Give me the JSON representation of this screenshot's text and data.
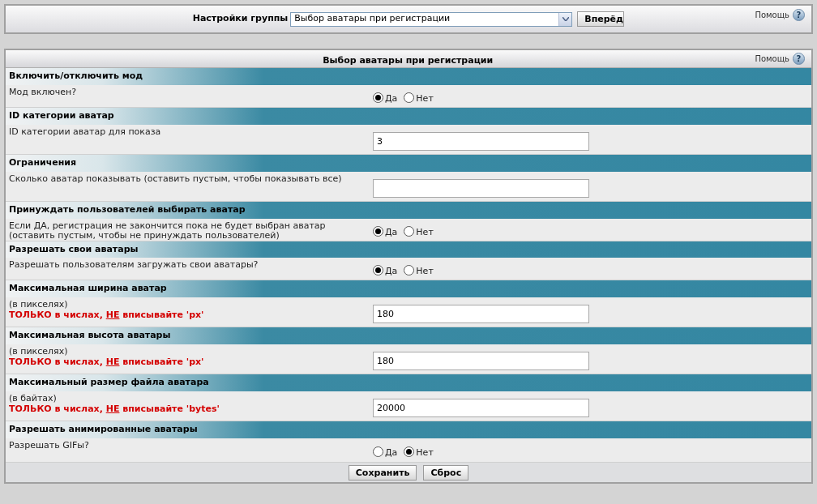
{
  "top_bar": {
    "label": "Настройки группы",
    "select_value": "Выбор аватары при регистрации",
    "go_button": "Вперёд",
    "help": "Помощь",
    "help_icon": "?"
  },
  "panel": {
    "title": "Выбор аватары при регистрации",
    "help": "Помощь",
    "help_icon": "?"
  },
  "sections": [
    {
      "title": "Включить/отключить мод",
      "kind": "radio",
      "description": [
        "Мод включен?"
      ],
      "options": [
        {
          "label": "Да",
          "selected": true
        },
        {
          "label": "Нет",
          "selected": false
        }
      ]
    },
    {
      "title": "ID категории аватар",
      "kind": "text",
      "description": [
        "ID категории аватар для показа"
      ],
      "value": "3"
    },
    {
      "title": "Ограничения",
      "kind": "text",
      "description": [
        "Сколько аватар показывать (оставить пустым, чтобы показывать все)"
      ]
    },
    {
      "title": "Принуждать пользователей выбирать аватар",
      "kind": "radio",
      "description": [
        "Если ДА, регистрация не закончится пока не будет выбран аватар",
        "(оставить пустым, чтобы не принуждать пользователей)"
      ],
      "options": [
        {
          "label": "Да",
          "selected": true
        },
        {
          "label": "Нет",
          "selected": false
        }
      ]
    },
    {
      "title": "Разрешать свои аватары",
      "kind": "radio",
      "description": [
        "Разрешать пользователям загружать свои аватары?"
      ],
      "options": [
        {
          "label": "Да",
          "selected": true
        },
        {
          "label": "Нет",
          "selected": false
        }
      ]
    },
    {
      "title": "Максимальная ширина аватар",
      "kind": "text",
      "description": [
        "(в пикселях)"
      ],
      "warning": {
        "before": "ТОЛЬКО в числах, ",
        "underlined": "НЕ",
        "after": " вписывайте 'px'"
      },
      "value": "180"
    },
    {
      "title": "Максимальная высота аватары",
      "kind": "text",
      "description": [
        "(в пикселях)"
      ],
      "warning": {
        "before": "ТОЛЬКО в числах, ",
        "underlined": "НЕ",
        "after": " вписывайте 'px'"
      },
      "value": "180"
    },
    {
      "title": "Максимальный размер файла аватара",
      "kind": "text",
      "description": [
        "(в байтах)"
      ],
      "warning": {
        "before": "ТОЛЬКО в числах, ",
        "underlined": "НЕ",
        "after": " вписывайте 'bytes'"
      },
      "value": "20000"
    },
    {
      "title": "Разрешать анимированные аватары",
      "kind": "radio",
      "description": [
        "Разрешать GIFы?"
      ],
      "options": [
        {
          "label": "Да",
          "selected": false
        },
        {
          "label": "Нет",
          "selected": true
        }
      ]
    }
  ],
  "buttons": [
    "Сохранить",
    "Сброс"
  ]
}
